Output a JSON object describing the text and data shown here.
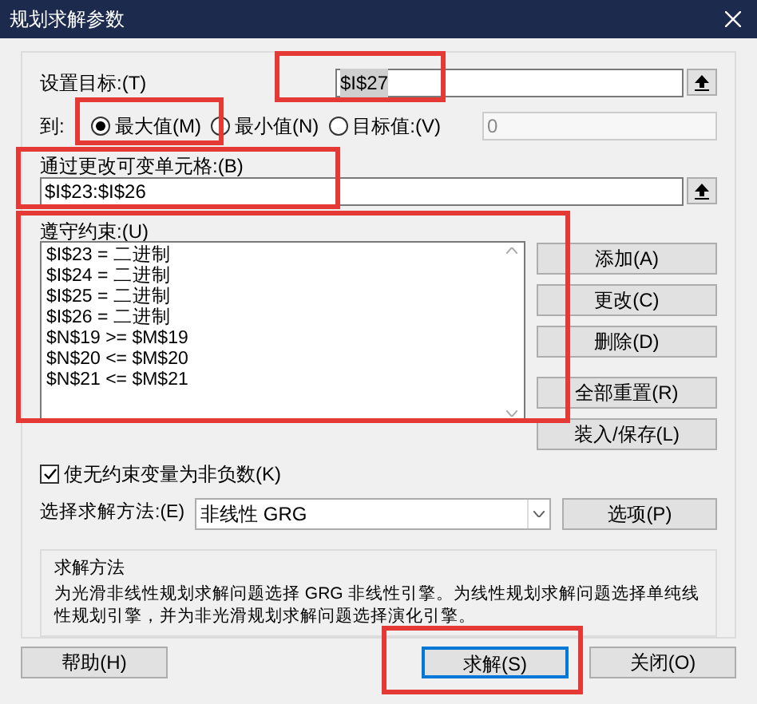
{
  "window": {
    "title": "规划求解参数"
  },
  "objective": {
    "label": "设置目标:(T)",
    "value": "$I$27"
  },
  "to": {
    "label": "到:",
    "options": [
      {
        "label": "最大值(M)",
        "selected": true
      },
      {
        "label": "最小值(N)",
        "selected": false
      },
      {
        "label": "目标值:(V)",
        "selected": false
      }
    ],
    "target_value": "0"
  },
  "changing_cells": {
    "label": "通过更改可变单元格:(B)",
    "value": "$I$23:$I$26"
  },
  "constraints": {
    "label": "遵守约束:(U)",
    "items": [
      "$I$23 = 二进制",
      "$I$24 = 二进制",
      "$I$25 = 二进制",
      "$I$26 = 二进制",
      "$N$19 >= $M$19",
      "$N$20 <= $M$20",
      "$N$21 <= $M$21"
    ],
    "buttons": [
      "添加(A)",
      "更改(C)",
      "删除(D)",
      "全部重置(R)",
      "装入/保存(L)"
    ]
  },
  "nonnegative": {
    "label": "使无约束变量为非负数(K)",
    "checked": true
  },
  "method": {
    "label": "选择求解方法:(E)",
    "value": "非线性 GRG",
    "options_button": "选项(P)"
  },
  "method_info": {
    "title": "求解方法",
    "text": "为光滑非线性规划求解问题选择 GRG 非线性引擎。为线性规划求解问题选择单纯线性规划引擎，并为非光滑规划求解问题选择演化引擎。"
  },
  "footer": [
    {
      "label": "帮助(H)",
      "focused": false
    },
    {
      "label": "求解(S)",
      "focused": true
    },
    {
      "label": "关闭(O)",
      "focused": false
    }
  ]
}
